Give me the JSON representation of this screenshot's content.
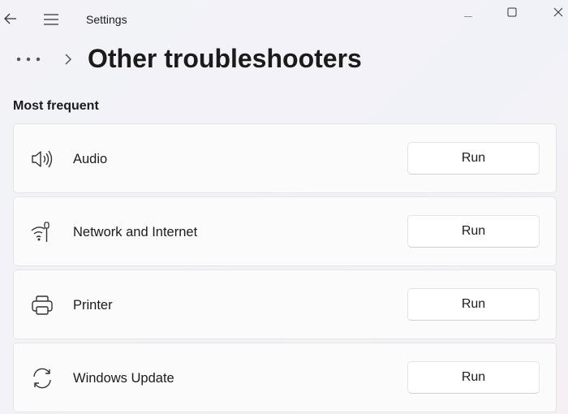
{
  "window": {
    "title": "Settings"
  },
  "page": {
    "title": "Other troubleshooters",
    "section": "Most frequent"
  },
  "items": [
    {
      "label": "Audio",
      "icon": "speaker-icon",
      "button": "Run"
    },
    {
      "label": "Network and Internet",
      "icon": "network-icon",
      "button": "Run"
    },
    {
      "label": "Printer",
      "icon": "printer-icon",
      "button": "Run"
    },
    {
      "label": "Windows Update",
      "icon": "sync-icon",
      "button": "Run"
    }
  ]
}
